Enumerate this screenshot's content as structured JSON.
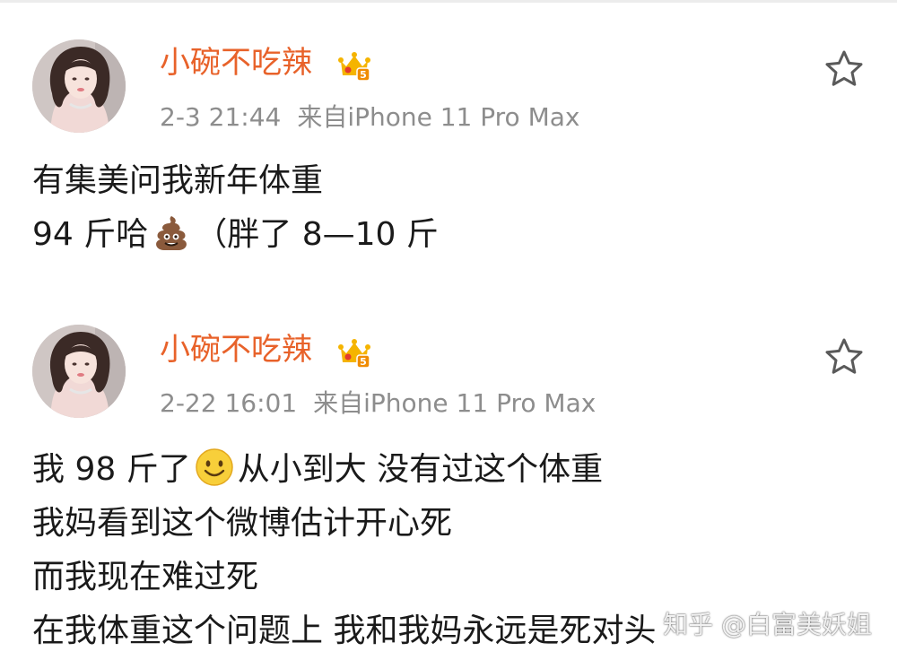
{
  "posts": [
    {
      "username": "小碗不吃辣",
      "badge_level": "5",
      "time": "2-3 21:44",
      "source": "来自iPhone 11 Pro Max",
      "lines": [
        {
          "before": "有集美问我新年体重",
          "emoji": "",
          "after": ""
        },
        {
          "before": "94 斤哈",
          "emoji": "poo-emoji",
          "after": "（胖了 8—10 斤"
        }
      ]
    },
    {
      "username": "小碗不吃辣",
      "badge_level": "5",
      "time": "2-22 16:01",
      "source": "来自iPhone 11 Pro Max",
      "lines": [
        {
          "before": "我 98 斤了",
          "emoji": "smile-emoji",
          "after": "从小到大 没有过这个体重"
        },
        {
          "before": "我妈看到这个微博估计开心死",
          "emoji": "",
          "after": ""
        },
        {
          "before": "而我现在难过死",
          "emoji": "",
          "after": ""
        },
        {
          "before": "在我体重这个问题上 我和我妈永远是死对头",
          "emoji": "",
          "after": ""
        }
      ]
    }
  ],
  "watermark": "知乎 @白富美妖姐",
  "colors": {
    "username": "#e8622a",
    "meta": "#8d8d8d",
    "text": "#1a1a1a",
    "badge": "#f5b400"
  }
}
